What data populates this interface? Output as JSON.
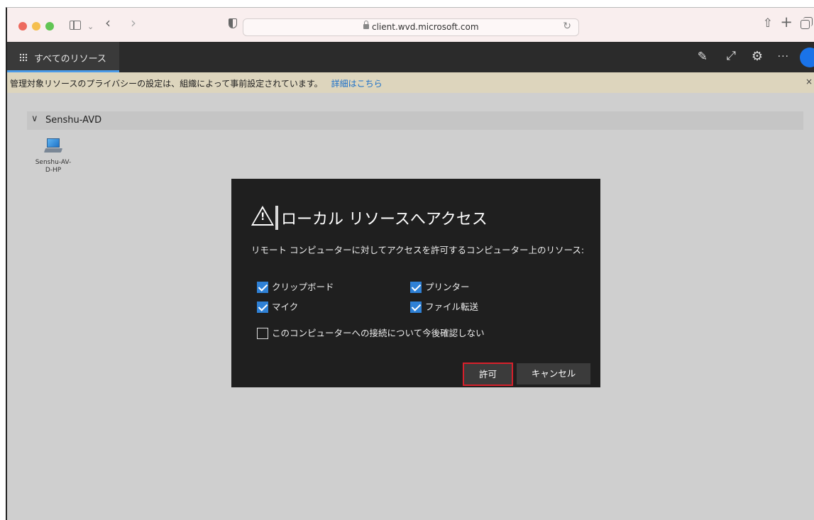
{
  "browser": {
    "url": "client.wvd.microsoft.com"
  },
  "app_bar": {
    "tab_label": "すべてのリソース",
    "more_label": "···"
  },
  "notice": {
    "text": "管理対象リソースのプライバシーの設定は、組織によって事前設定されています。",
    "link": "詳細はこちら",
    "close": "×"
  },
  "workspace": {
    "group_title": "Senshu-AVD",
    "resources": [
      {
        "label_line1": "Senshu-AV-",
        "label_line2": "D-HP"
      }
    ]
  },
  "dialog": {
    "title": "ローカル リソースへアクセス",
    "description": "リモート コンピューターに対してアクセスを許可するコンピューター上のリソース:",
    "options": [
      {
        "label": "クリップボード",
        "checked": true
      },
      {
        "label": "プリンター",
        "checked": true
      },
      {
        "label": "マイク",
        "checked": true
      },
      {
        "label": "ファイル転送",
        "checked": true
      }
    ],
    "dont_ask": {
      "label": "このコンピューターへの接続について今後確認しない",
      "checked": false
    },
    "allow_label": "許可",
    "cancel_label": "キャンセル"
  },
  "colors": {
    "accent": "#2f81d6",
    "highlight": "#d7202b",
    "dialog_bg": "#1f1f1f",
    "notice_bg": "#ddd5bd"
  }
}
